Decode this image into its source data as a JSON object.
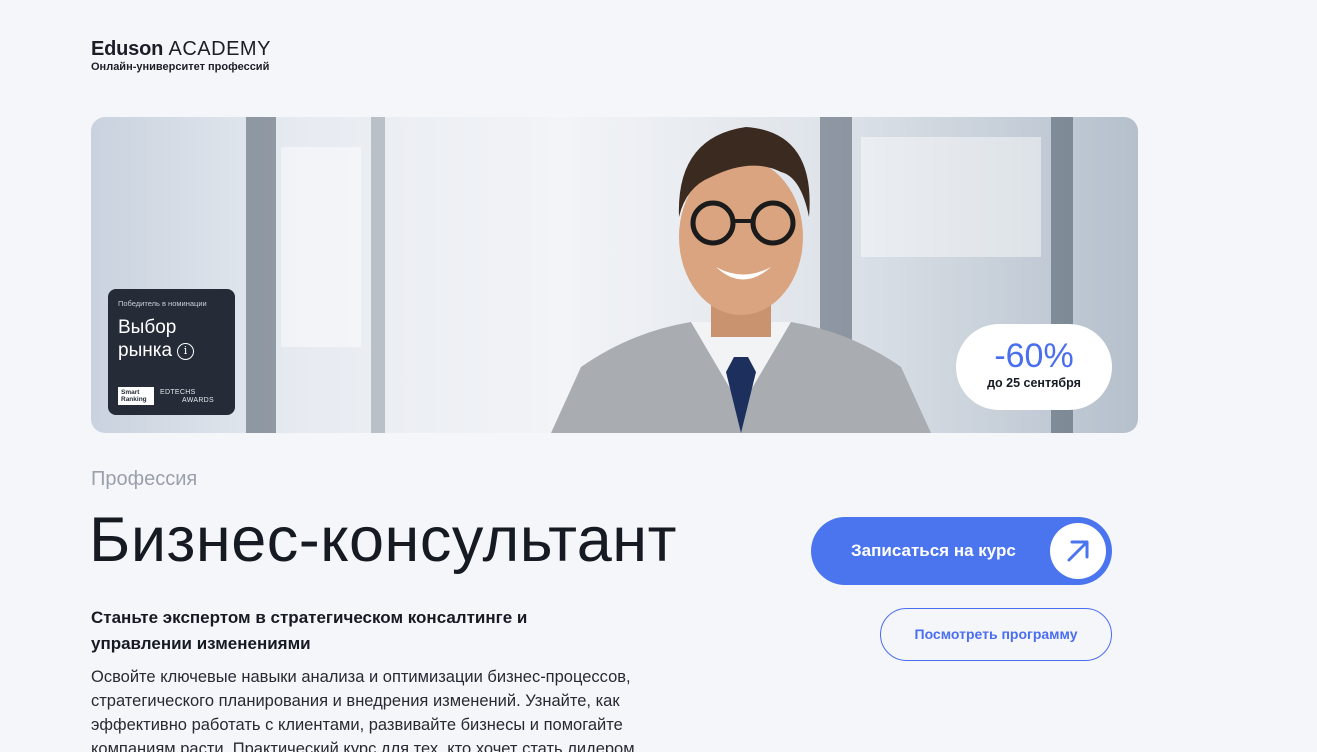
{
  "logo": {
    "brand": "Eduson",
    "academy": "ACADEMY",
    "tagline": "Онлайн-университет профессий"
  },
  "hero": {
    "award": {
      "caption": "Победитель в номинации",
      "title_line1": "Выбор",
      "title_line2": "рынка",
      "info_icon": "info-icon",
      "logo1": "Smart Ranking",
      "logo2_line1": "EDTECHS",
      "logo2_line2": "AWARDS"
    },
    "discount": {
      "value": "-60%",
      "until": "до 25 сентября"
    }
  },
  "course": {
    "kicker": "Профессия",
    "title": "Бизнес-консультант",
    "lead": "Станьте экспертом в стратегическом консалтинге и управлении изменениями",
    "description": "Освойте ключевые навыки анализа и оптимизации бизнес-процессов, стратегического планирования и внедрения изменений. Узнайте, как эффективно работать с клиентами, развивайте бизнесы и помогайте компаниям расти. Практический курс для тех, кто хочет стать лидером"
  },
  "actions": {
    "enroll_label": "Записаться на курс",
    "enroll_icon": "arrow-up-right-icon",
    "program_label": "Посмотреть программу"
  },
  "colors": {
    "accent": "#4a75ef",
    "background": "#f5f6fa",
    "text": "#161a23",
    "badge_bg": "#252c38"
  }
}
